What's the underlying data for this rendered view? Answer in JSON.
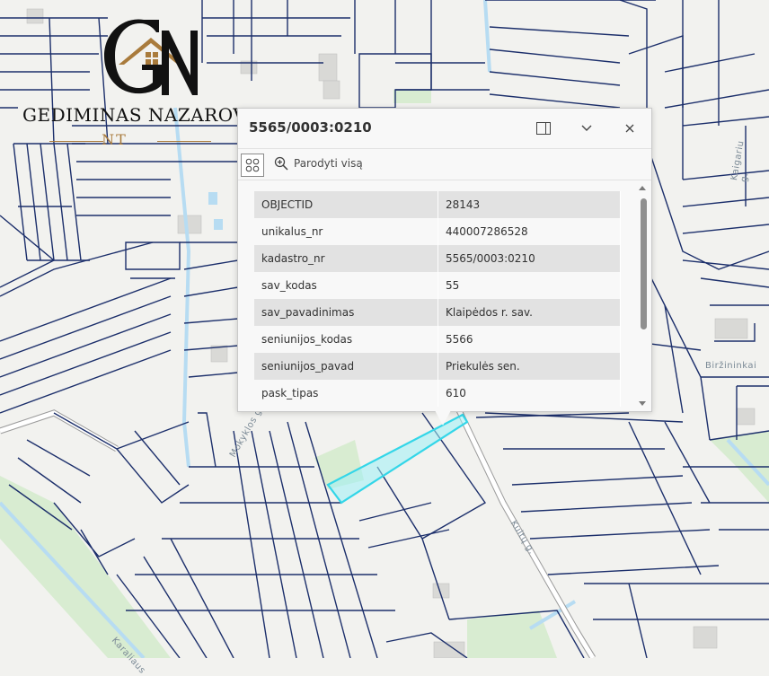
{
  "popup": {
    "title": "5565/0003:0210",
    "dock_label": "dock-popup",
    "collapse_label": "collapse",
    "close_label": "close",
    "zoom_label": "Parodyti visą",
    "rows": [
      {
        "key": "OBJECTID",
        "value": "28143"
      },
      {
        "key": "unikalus_nr",
        "value": "440007286528"
      },
      {
        "key": "kadastro_nr",
        "value": "5565/0003:0210"
      },
      {
        "key": "sav_kodas",
        "value": "55"
      },
      {
        "key": "sav_pavadinimas",
        "value": "Klaipėdos r. sav."
      },
      {
        "key": "seniunijos_kodas",
        "value": "5566"
      },
      {
        "key": "seniunijos_pavad",
        "value": "Priekulės sen."
      },
      {
        "key": "pask_tipas",
        "value": "610"
      }
    ]
  },
  "logo": {
    "name": "GEDIMINAS NAZAROVAS",
    "suffix": "NT"
  },
  "map_labels": {
    "birzininkai": "Biržininkai",
    "kulto_g": "Kultų g.",
    "kairiu_g": "Kaigariu g.",
    "mokyklos": "Mokyklos g.",
    "karalius": "Karaliaus"
  },
  "colors": {
    "parcel_line": "#1c2f6b",
    "selected_parcel": "#33d6e8",
    "water": "#b7dcf2",
    "green": "#d8ecd1",
    "logo_gold": "#a97b3c"
  }
}
